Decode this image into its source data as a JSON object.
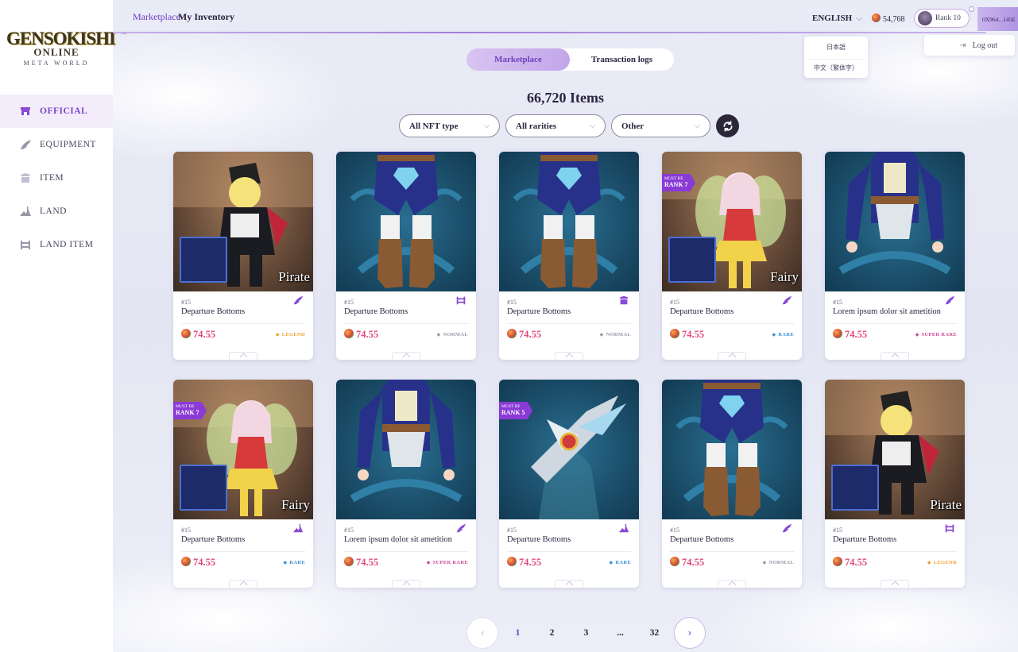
{
  "sidebar": {
    "logo": {
      "line1": "GENSOKISHI",
      "line2": "ONLINE",
      "line3": "META WORLD"
    },
    "items": [
      {
        "label": "OFFICIAL",
        "icon": "shop-icon",
        "active": true
      },
      {
        "label": "EQUIPMENT",
        "icon": "wing-icon",
        "active": false
      },
      {
        "label": "ITEM",
        "icon": "item-icon",
        "active": false
      },
      {
        "label": "LAND",
        "icon": "land-icon",
        "active": false
      },
      {
        "label": "LAND ITEM",
        "icon": "land-item-icon",
        "active": false
      }
    ]
  },
  "header": {
    "links": [
      "Marketplace",
      "My Inventory"
    ],
    "language": "ENGLISH",
    "language_options": [
      "日本語",
      "中文（繁体字）"
    ],
    "balance": "54,768",
    "rank": "Rank 10",
    "wallet": "0X964...145E",
    "logout": "Log out"
  },
  "main": {
    "tabs": [
      "Marketplace",
      "Transaction logs"
    ],
    "count_label": "66,720 Items",
    "filters": [
      "All NFT type",
      "All rarities",
      "Other"
    ],
    "colors": {
      "accent": "#6e3dbf",
      "price": "#e0487d",
      "legend": "#f0a030",
      "normal": "#9a98a8",
      "rare": "#3b8fd6",
      "super_rare": "#d0489c"
    },
    "cards": [
      {
        "art": "pirate",
        "overlay": "Pirate",
        "badge": null,
        "num": "#15",
        "name": "Departure Bottoms",
        "type_icon": "wing-icon",
        "price": "74.55",
        "rarity": "LEGEND",
        "rarity_key": "legend"
      },
      {
        "art": "bottoms",
        "overlay": "",
        "badge": null,
        "num": "#15",
        "name": "Departure Bottoms",
        "type_icon": "land-item-icon",
        "price": "74.55",
        "rarity": "NORMAL",
        "rarity_key": "normal"
      },
      {
        "art": "bottoms",
        "overlay": "",
        "badge": null,
        "num": "#15",
        "name": "Departure Bottoms",
        "type_icon": "item-icon",
        "price": "74.55",
        "rarity": "NORMAL",
        "rarity_key": "normal"
      },
      {
        "art": "fairy",
        "overlay": "Fairy",
        "badge": {
          "top": "MUST BE",
          "rank": "RANK 7"
        },
        "num": "#15",
        "name": "Departure Bottoms",
        "type_icon": "wing-icon",
        "price": "74.55",
        "rarity": "RARE",
        "rarity_key": "rare"
      },
      {
        "art": "jacket",
        "overlay": "",
        "badge": null,
        "num": "#15",
        "name": "Lorem ipsum dolor sit ametition",
        "type_icon": "wing-icon",
        "price": "74.55",
        "rarity": "SUPER RARE",
        "rarity_key": "super_rare"
      },
      {
        "art": "fairy",
        "overlay": "Fairy",
        "badge": {
          "top": "MUST BE",
          "rank": "RANK 7"
        },
        "num": "#15",
        "name": "Departure Bottoms",
        "type_icon": "land-icon",
        "price": "74.55",
        "rarity": "RARE",
        "rarity_key": "rare"
      },
      {
        "art": "jacket",
        "overlay": "",
        "badge": null,
        "num": "#15",
        "name": "Lorem ipsum dolor sit ametition",
        "type_icon": "wing-icon",
        "price": "74.55",
        "rarity": "SUPER RARE",
        "rarity_key": "super_rare"
      },
      {
        "art": "weapon",
        "overlay": "",
        "badge": {
          "top": "MUST BE",
          "rank": "RANK 5"
        },
        "num": "#15",
        "name": "Departure Bottoms",
        "type_icon": "land-icon",
        "price": "74.55",
        "rarity": "RARE",
        "rarity_key": "rare"
      },
      {
        "art": "bottoms",
        "overlay": "",
        "badge": null,
        "num": "#15",
        "name": "Departure Bottoms",
        "type_icon": "wing-icon",
        "price": "74.55",
        "rarity": "NORMAL",
        "rarity_key": "normal"
      },
      {
        "art": "pirate",
        "overlay": "Pirate",
        "badge": null,
        "num": "#15",
        "name": "Departure Bottoms",
        "type_icon": "land-item-icon",
        "price": "74.55",
        "rarity": "LEGEND",
        "rarity_key": "legend"
      }
    ]
  },
  "pagination": {
    "pages": [
      "1",
      "2",
      "3",
      "...",
      "32"
    ],
    "current": "1"
  }
}
